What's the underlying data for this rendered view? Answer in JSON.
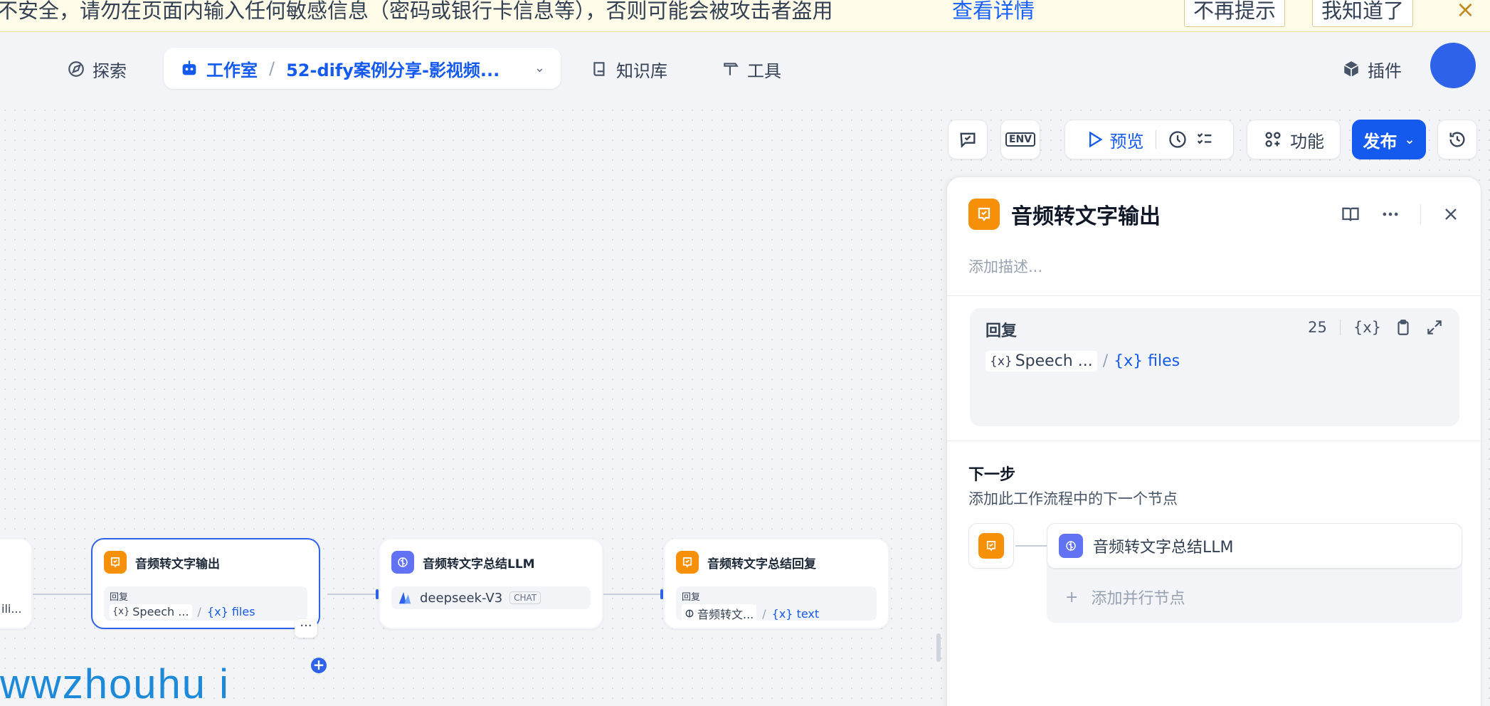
{
  "banner": {
    "text": "不安全，请勿在页面内输入任何敏感信息（密码或银行卡信息等），否则可能会被攻击者盗用",
    "link": "查看详情",
    "dismiss_forever": "不再提示",
    "ok": "我知道了",
    "close": "×"
  },
  "nav": {
    "explore": "探索",
    "studio": "工作室",
    "separator": "/",
    "app_name": "52-dify案例分享-影视频...",
    "knowledge": "知识库",
    "tools": "工具",
    "plugins": "插件"
  },
  "toolbar": {
    "env": "ENV",
    "preview": "预览",
    "features": "功能",
    "publish": "发布"
  },
  "nodes": {
    "partial_text": "ili...",
    "n1": {
      "title": "音频转文字输出",
      "caption": "回复",
      "var_prefix": "{x}",
      "var_source": "Speech ...",
      "var_slash": "/",
      "var_name": "{x} files"
    },
    "n2": {
      "title": "音频转文字总结LLM",
      "model": "deepseek-V3",
      "badge": "CHAT"
    },
    "n3": {
      "title": "音频转文字总结回复",
      "caption": "回复",
      "var_source": "音频转文...",
      "var_slash": "/",
      "var_name": "{x} text"
    },
    "more": "···",
    "add": "+"
  },
  "panel": {
    "title": "音频转文字输出",
    "description_placeholder": "添加描述...",
    "reply_label": "回复",
    "char_count": "25",
    "var_insert": "{x}",
    "reply_var_prefix": "{x}",
    "reply_var_source": "Speech ...",
    "reply_var_slash": "/",
    "reply_var_name": "{x} files",
    "next_title": "下一步",
    "next_desc": "添加此工作流程中的下一个节点",
    "next_node": "音频转文字总结LLM",
    "add_parallel_icon": "+",
    "add_parallel": "添加并行节点"
  },
  "watermark": "wwzhouhu i",
  "colors": {
    "accent": "#155aef",
    "orange_node": "#f79009",
    "indigo_node": "#6172f3",
    "banner_bg": "#fefbe8"
  }
}
